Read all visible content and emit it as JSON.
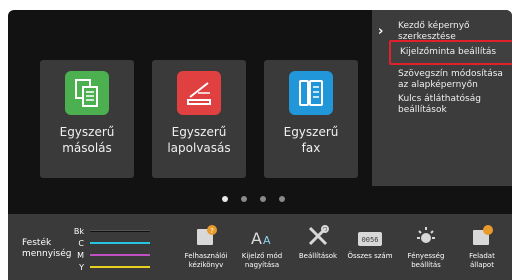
{
  "tiles": [
    {
      "line1": "Egyszerű",
      "line2": "másolás",
      "icon": "copy-icon",
      "color": "#4caf50"
    },
    {
      "line1": "Egyszerű",
      "line2": "lapolvasás",
      "icon": "scanner-icon",
      "color": "#e04040"
    },
    {
      "line1": "Egyszerű",
      "line2": "fax",
      "icon": "fax-icon",
      "color": "#2196d8"
    }
  ],
  "pager": {
    "pages": 4,
    "active": 1
  },
  "menu": {
    "items": [
      {
        "lines": [
          "Kezdő képernyő",
          "szerkesztése"
        ]
      },
      {
        "lines": [
          "Kijelzőminta beállítás"
        ],
        "selected": true
      },
      {
        "lines": [
          "Szövegszín módosítása",
          "az alapképernyőn"
        ]
      },
      {
        "lines": [
          "Kulcs átláthatóság",
          "beállítások"
        ]
      }
    ]
  },
  "toner": {
    "title": [
      "Festék",
      "mennyiség"
    ],
    "rows": [
      {
        "label": "Bk",
        "color": "#111111"
      },
      {
        "label": "C",
        "color": "#27c3e0"
      },
      {
        "label": "M",
        "color": "#c050c0"
      },
      {
        "label": "Y",
        "color": "#e8d020"
      }
    ]
  },
  "shortcuts": [
    {
      "lines": [
        "Felhasználói",
        "kézikönyv"
      ],
      "icon": "manual-icon"
    },
    {
      "lines": [
        "Kijelző mód",
        "nagyítása"
      ],
      "icon": "display-zoom-icon"
    },
    {
      "lines": [
        "Beállítások"
      ],
      "icon": "settings-icon"
    },
    {
      "lines": [
        "Összes szám"
      ],
      "icon": "counter-icon"
    },
    {
      "lines": [
        "Fényesség",
        "beállítás"
      ],
      "icon": "brightness-icon"
    },
    {
      "lines": [
        "Feladat",
        "állapot"
      ],
      "icon": "job-status-icon"
    }
  ]
}
